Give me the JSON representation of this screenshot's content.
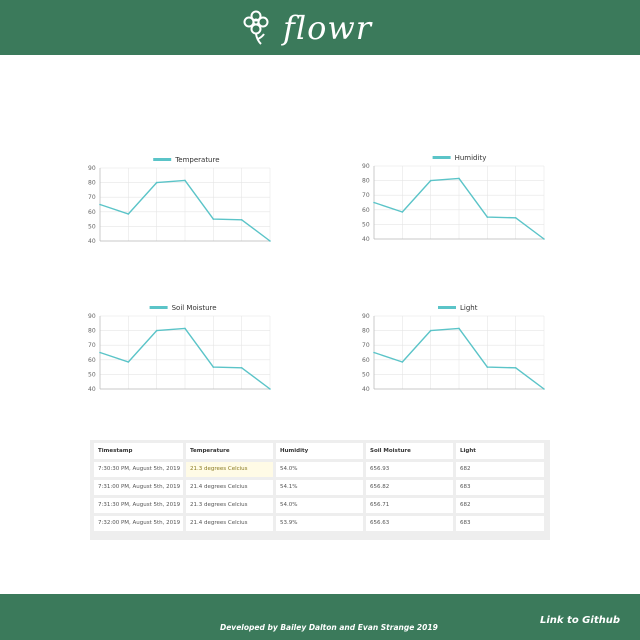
{
  "brand": {
    "name": "flowr",
    "icon": "flower-icon"
  },
  "colors": {
    "header_bg": "#3b7a5b",
    "line": "#5bc4c8",
    "grid": "#e6e6e6"
  },
  "chart_data": [
    {
      "type": "line",
      "title": "",
      "series": [
        {
          "name": "Temperature",
          "values": [
            65,
            58.5,
            80,
            81.5,
            55,
            54.5,
            40
          ]
        }
      ],
      "yticks": [
        90,
        80,
        70,
        60,
        50,
        40
      ],
      "ylim": [
        40,
        90
      ],
      "grid": true,
      "legend": "top"
    },
    {
      "type": "line",
      "title": "",
      "series": [
        {
          "name": "Humidity",
          "values": [
            65,
            58.5,
            80,
            81.5,
            55,
            54.5,
            40
          ]
        }
      ],
      "yticks": [
        90,
        80,
        70,
        60,
        50,
        40
      ],
      "ylim": [
        40,
        90
      ],
      "grid": true,
      "legend": "top"
    },
    {
      "type": "line",
      "title": "",
      "series": [
        {
          "name": "Soil Moisture",
          "values": [
            65,
            58.5,
            80,
            81.5,
            55,
            54.5,
            40
          ]
        }
      ],
      "yticks": [
        90,
        80,
        70,
        60,
        50,
        40
      ],
      "ylim": [
        40,
        90
      ],
      "grid": true,
      "legend": "top"
    },
    {
      "type": "line",
      "title": "",
      "series": [
        {
          "name": "Light",
          "values": [
            65,
            58.5,
            80,
            81.5,
            55,
            54.5,
            40
          ]
        }
      ],
      "yticks": [
        90,
        80,
        70,
        60,
        50,
        40
      ],
      "ylim": [
        40,
        90
      ],
      "grid": true,
      "legend": "top"
    }
  ],
  "table": {
    "headers": [
      "Timestamp",
      "Temperature",
      "Humidity",
      "Soil Moisture",
      "Light"
    ],
    "rows": [
      [
        "7:30:30 PM, August 5th, 2019",
        "21.3 degrees Celcius",
        "54.0%",
        "656.93",
        "682"
      ],
      [
        "7:31:00 PM, August 5th, 2019",
        "21.4 degrees Celcius",
        "54.1%",
        "656.82",
        "683"
      ],
      [
        "7:31:30 PM, August 5th, 2019",
        "21.3 degrees Celcius",
        "54.0%",
        "656.71",
        "682"
      ],
      [
        "7:32:00 PM, August 5th, 2019",
        "21.4 degrees Celcius",
        "53.9%",
        "656.63",
        "683"
      ]
    ]
  },
  "footer": {
    "credit": "Developed by Bailey Dalton and Evan Strange 2019",
    "github_link": "Link to Github"
  }
}
